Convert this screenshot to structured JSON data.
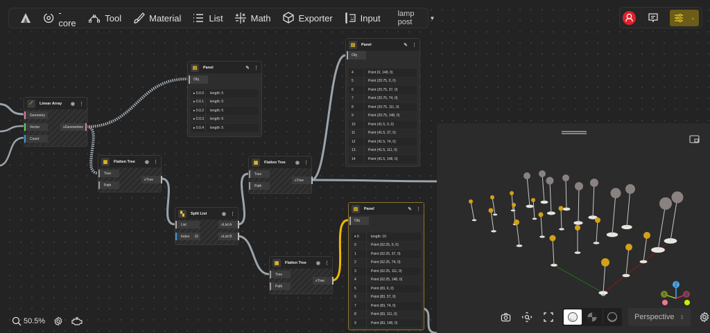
{
  "toolbar": {
    "items": [
      {
        "icon": "logo-icon",
        "label": ""
      },
      {
        "icon": "core-icon",
        "label": "-core"
      },
      {
        "icon": "tool-icon",
        "label": "Tool"
      },
      {
        "icon": "brush-icon",
        "label": "Material"
      },
      {
        "icon": "list-icon",
        "label": "List"
      },
      {
        "icon": "math-icon",
        "label": "Math"
      },
      {
        "icon": "cube-icon",
        "label": "Exporter"
      },
      {
        "icon": "input-icon",
        "label": "Input"
      }
    ],
    "project_select": "lamp post"
  },
  "top_right": {
    "avatar_color": "#e0202a",
    "accent": "#7a6a1a"
  },
  "nodes": {
    "linear_array": {
      "title": "Linear Array",
      "inputs": [
        "Geometry",
        "Vector",
        "Count"
      ],
      "outputs": [
        "Geometries"
      ]
    },
    "flatten1": {
      "title": "Flatten Tree",
      "inputs": [
        "Tree",
        "Path"
      ],
      "outputs": [
        "Tree"
      ]
    },
    "flatten2": {
      "title": "Flatten Tree",
      "inputs": [
        "Tree",
        "Path"
      ],
      "outputs": [
        "Tree"
      ]
    },
    "flatten3": {
      "title": "Flatten Tree",
      "inputs": [
        "Tree",
        "Path"
      ],
      "outputs": [
        "Tree"
      ]
    },
    "split_list": {
      "title": "Split List",
      "inputs": [
        "List",
        "Index"
      ],
      "index_value": "15",
      "outputs": [
        "List A",
        "List B"
      ]
    }
  },
  "panels": {
    "p1": {
      "title": "Panel",
      "input": "Obj",
      "rows": [
        [
          "▸ 0.0.0",
          "length: 5"
        ],
        [
          "▸ 0.0.1",
          "length: 5"
        ],
        [
          "▸ 0.0.2",
          "length: 5"
        ],
        [
          "▸ 0.0.3",
          "length: 5"
        ],
        [
          "▸ 0.0.4",
          "length: 5"
        ]
      ]
    },
    "p2": {
      "title": "Panel",
      "input": "Obj",
      "rows": [
        [
          "4",
          "Point (0, 148, 0)"
        ],
        [
          "5",
          "Point (20.75, 0, 0)"
        ],
        [
          "6",
          "Point (20.75, 37, 0)"
        ],
        [
          "7",
          "Point (20.75, 74, 0)"
        ],
        [
          "8",
          "Point (20.75, 111, 0)"
        ],
        [
          "9",
          "Point (20.75, 148, 0)"
        ],
        [
          "10",
          "Point (41.5, 0, 0)"
        ],
        [
          "11",
          "Point (41.5, 37, 0)"
        ],
        [
          "12",
          "Point (41.5, 74, 0)"
        ],
        [
          "13",
          "Point (41.5, 111, 0)"
        ],
        [
          "14",
          "Point (41.5, 148, 0)"
        ]
      ]
    },
    "p3": {
      "title": "Panel",
      "input": "Obj",
      "rows": [
        [
          "▾ 0",
          "length: 10"
        ],
        [
          "0",
          "Point (62.25, 0, 0)"
        ],
        [
          "1",
          "Point (62.25, 37, 0)"
        ],
        [
          "2",
          "Point (62.25, 74, 0)"
        ],
        [
          "3",
          "Point (62.25, 111, 0)"
        ],
        [
          "4",
          "Point (62.25, 148, 0)"
        ],
        [
          "5",
          "Point (83, 0, 0)"
        ],
        [
          "6",
          "Point (83, 37, 0)"
        ],
        [
          "7",
          "Point (83, 74, 0)"
        ],
        [
          "8",
          "Point (83, 111, 0)"
        ],
        [
          "9",
          "Point (83, 148, 0)"
        ]
      ]
    }
  },
  "viewport": {
    "camera_mode": "Perspective",
    "shading_modes": [
      "solid",
      "matcap",
      "wireframe"
    ],
    "active_shading": "solid",
    "gizmo_axes": [
      "Z",
      "Y",
      "X"
    ],
    "colors": {
      "highlight": "#d4a017",
      "lamp_gray": "#8a8280",
      "x_axis": "#8a1a1a",
      "y_axis": "#1a7a1a",
      "z_axis": "#4aa8f0"
    }
  },
  "status": {
    "zoom": "50.5%"
  }
}
